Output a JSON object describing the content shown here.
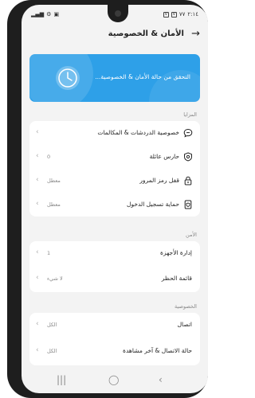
{
  "status_bar": {
    "time": "٢:١٤",
    "battery": "٧٧",
    "left_icons": [
      "settings-icon",
      "sim-icon",
      "signal-icon"
    ],
    "right_icons": [
      "v-icon",
      "v-icon"
    ]
  },
  "header": {
    "title": "الأمان & الخصوصية",
    "back_icon": "arrow-right-icon"
  },
  "banner": {
    "text": "التحقق من حالة الأمان & الخصوصية...",
    "icon": "shield-clock-icon",
    "color": "#2ea0e8"
  },
  "sections": {
    "features": {
      "label": "المزايا",
      "items": [
        {
          "label": "خصوصية الدردشات & المكالمات",
          "value": "",
          "icon": "chat-bubble-icon"
        },
        {
          "label": "حارس عائلة",
          "value": "0",
          "icon": "shield-icon"
        },
        {
          "label": "قفل رمز المرور",
          "value": "معطل",
          "icon": "lock-icon"
        },
        {
          "label": "حماية تسجيل الدخول",
          "value": "معطل",
          "icon": "phone-shield-icon"
        }
      ]
    },
    "security": {
      "label": "الأمن",
      "items": [
        {
          "label": "إدارة الأجهزة",
          "value": "1"
        },
        {
          "label": "قائمة الحظر",
          "value": "لا شيء"
        }
      ]
    },
    "privacy": {
      "label": "الخصوصية",
      "items": [
        {
          "label": "اتصال",
          "value": "الكل"
        },
        {
          "label": "حالة الاتصال & آخر مشاهدة",
          "value": "الكل"
        }
      ]
    }
  },
  "nav": {
    "recents_icon": "recents-icon",
    "home_icon": "home-icon",
    "back_icon": "nav-back-icon"
  }
}
